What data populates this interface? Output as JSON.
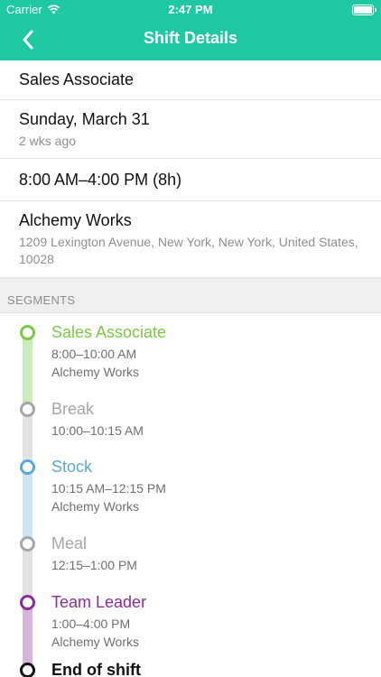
{
  "status_bar": {
    "carrier": "Carrier",
    "time": "2:47 PM"
  },
  "nav": {
    "title": "Shift Details"
  },
  "details": {
    "role": "Sales Associate",
    "date": "Sunday, March 31",
    "relative_date": "2 wks ago",
    "time_range": "8:00 AM–4:00 PM (8h)",
    "location_name": "Alchemy Works",
    "address": "1209 Lexington Avenue, New York, New York, United States, 10028"
  },
  "segments_header": "SEGMENTS",
  "segments": [
    {
      "title": "Sales Associate",
      "time": "8:00–10:00 AM",
      "location": "Alchemy Works",
      "color": "#7ac943",
      "line_color": "#cdeabb"
    },
    {
      "title": "Break",
      "time": "10:00–10:15 AM",
      "location": "",
      "color": "#a6a6a6",
      "line_color": "#e2e2e2"
    },
    {
      "title": "Stock",
      "time": "10:15 AM–12:15 PM",
      "location": "Alchemy Works",
      "color": "#5aa9d6",
      "line_color": "#cfe4f2"
    },
    {
      "title": "Meal",
      "time": "12:15–1:00 PM",
      "location": "",
      "color": "#a6a6a6",
      "line_color": "#e2e2e2"
    },
    {
      "title": "Team Leader",
      "time": "1:00–4:00 PM",
      "location": "Alchemy Works",
      "color": "#8e2b9c",
      "line_color": "#d7b3dd"
    },
    {
      "title": "End of shift",
      "time": "",
      "location": "",
      "color": "#111111",
      "line_color": "#ffffff"
    }
  ]
}
